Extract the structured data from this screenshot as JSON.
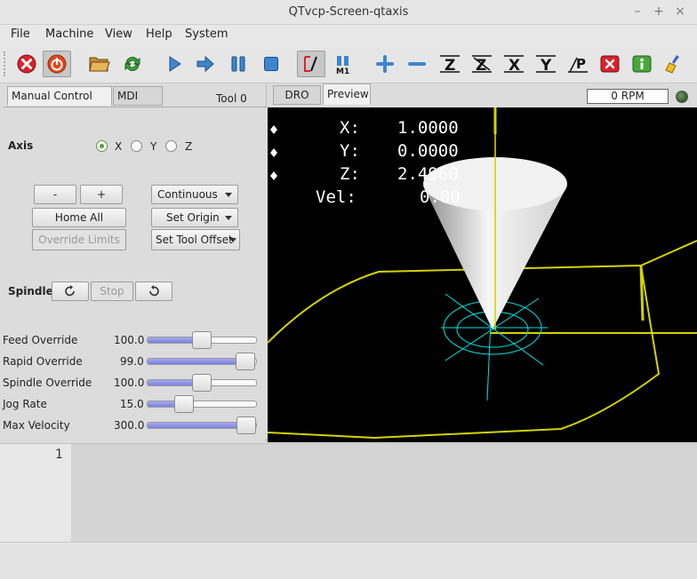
{
  "window": {
    "title": "QTvcp-Screen-qtaxis",
    "minimize": "–",
    "maximize": "+",
    "close": "×"
  },
  "menu": [
    "File",
    "Machine",
    "View",
    "Help",
    "System"
  ],
  "toolbar": {
    "tools": [
      "estop-icon",
      "power-icon",
      "open-file-icon",
      "reload-icon",
      "run-icon",
      "step-icon",
      "pause-icon",
      "stop-icon",
      "block-delete-icon",
      "optional-stop-icon",
      "zoom-in-icon",
      "zoom-out-icon",
      "view-z-icon",
      "view-z2-icon",
      "view-x-icon",
      "view-y-icon",
      "view-p-icon",
      "clear-icon",
      "info-icon",
      "clean-icon"
    ],
    "view_labels": {
      "z": "Z",
      "z2": "Z",
      "x": "X",
      "y": "Y",
      "p": "P",
      "m1": "M1"
    }
  },
  "left": {
    "tabs": [
      "Manual Control [F3]",
      "MDI [F5]"
    ],
    "tool_label": "Tool 0",
    "axis_label": "Axis",
    "axes": [
      {
        "label": "X",
        "checked": true
      },
      {
        "label": "Y",
        "checked": false
      },
      {
        "label": "Z",
        "checked": false
      }
    ],
    "jog_minus": "-",
    "jog_plus": "+",
    "jog_mode": "Continuous",
    "home_all": "Home All",
    "set_origin": "Set Origin",
    "override_limits": "Override Limits",
    "set_tool_offset": "Set Tool Offset",
    "spindle_label": "Spindle:",
    "spindle_stop": "Stop",
    "sliders": [
      {
        "label": "Feed Override",
        "value": "100.0",
        "level": 0.5
      },
      {
        "label": "Rapid Override",
        "value": "99.0",
        "level": 0.99
      },
      {
        "label": "Spindle Override",
        "value": "100.0",
        "level": 0.5
      },
      {
        "label": "Jog Rate",
        "value": "15.0",
        "level": 0.3
      },
      {
        "label": "Max Velocity",
        "value": "300.0",
        "level": 1.0
      }
    ]
  },
  "right": {
    "tabs": [
      "DRO",
      "Preview"
    ],
    "rpm": "0 RPM",
    "dro": [
      {
        "axis": "X:",
        "value": "1.0000"
      },
      {
        "axis": "Y:",
        "value": "0.0000"
      },
      {
        "axis": "Z:",
        "value": "2.4960"
      },
      {
        "axis": "Vel:",
        "value": "0.00"
      }
    ]
  },
  "editor": {
    "line_number": "1"
  },
  "colors": {
    "toolpath": "#d4d400",
    "tool": "#f2f2f2",
    "origin": "#00e5e5",
    "background": "#000000"
  }
}
